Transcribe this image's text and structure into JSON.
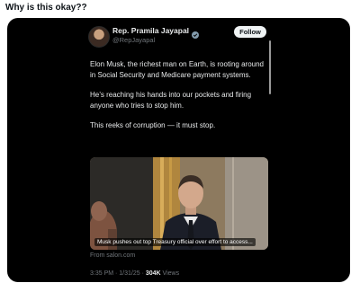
{
  "post": {
    "title": "Why is this okay??"
  },
  "tweet": {
    "display_name": "Rep. Pramila Jayapal",
    "handle": "@RepJayapal",
    "follow_label": "Follow",
    "paragraphs": [
      "Elon Musk, the richest man on Earth, is rooting around in Social Security and Medicare payment systems.",
      "He’s reaching his hands into our pockets and firing anyone who tries to stop him.",
      "This reeks of corruption — it must stop."
    ],
    "media": {
      "caption": "Musk pushes out top Treasury official over effort to access..."
    },
    "link_source": "From salon.com",
    "time": "3:35 PM · 1/31/25 · ",
    "views_count": "304K",
    "views_label": " Views"
  },
  "colors": {
    "card_bg": "#000000",
    "text_primary": "#e7e9ea",
    "text_secondary": "#71767b",
    "verified": "#829aab"
  },
  "icons": {
    "verified": "verified-badge-icon",
    "avatar": "avatar"
  }
}
